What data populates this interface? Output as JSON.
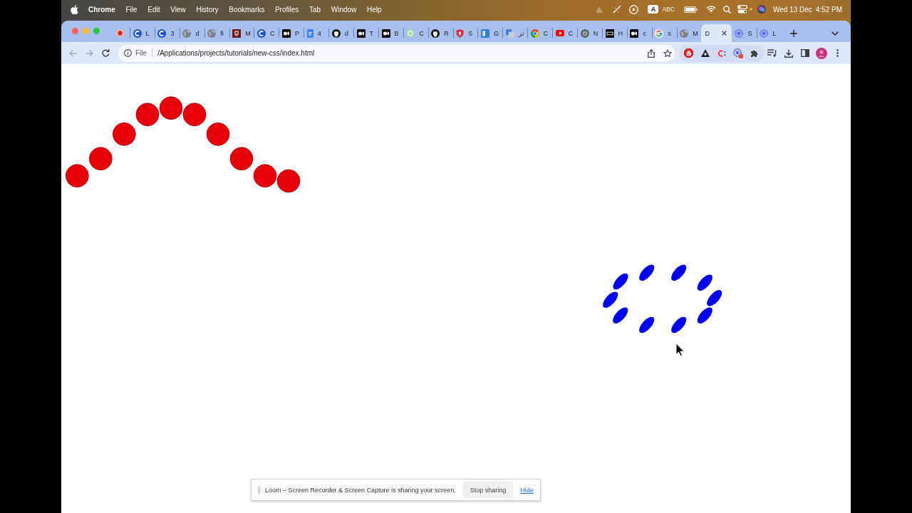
{
  "menu_bar": {
    "app": "Chrome",
    "menus": [
      "File",
      "Edit",
      "View",
      "History",
      "Bookmarks",
      "Profiles",
      "Tab",
      "Window",
      "Help"
    ],
    "input_badge": "A",
    "input_source": "ABC",
    "date": "Wed 13 Dec",
    "time": "4:52 PM"
  },
  "browser": {
    "tabs": [
      {
        "kind": "record",
        "pinned": true,
        "selected": false
      },
      {
        "kind": "c",
        "title": "L",
        "pinned": false,
        "selected": false
      },
      {
        "kind": "c",
        "title": "3",
        "pinned": false,
        "selected": false
      },
      {
        "kind": "globe",
        "title": "d",
        "pinned": false,
        "selected": false
      },
      {
        "kind": "globe",
        "title": "fi",
        "pinned": false,
        "selected": false
      },
      {
        "kind": "crest",
        "title": "M",
        "pinned": false,
        "selected": false
      },
      {
        "kind": "c",
        "title": "C",
        "pinned": false,
        "selected": false
      },
      {
        "kind": "dots",
        "title": "P",
        "pinned": false,
        "selected": false
      },
      {
        "kind": "doc",
        "title": "4",
        "pinned": false,
        "selected": false
      },
      {
        "kind": "cat",
        "title": "d",
        "pinned": false,
        "selected": false
      },
      {
        "kind": "dots",
        "title": "T",
        "pinned": false,
        "selected": false
      },
      {
        "kind": "dots",
        "title": "B",
        "pinned": false,
        "selected": false
      },
      {
        "kind": "flower",
        "title": "C",
        "pinned": false,
        "selected": false
      },
      {
        "kind": "cat",
        "title": "R",
        "pinned": false,
        "selected": false
      },
      {
        "kind": "shield",
        "title": "S",
        "pinned": false,
        "selected": false
      },
      {
        "kind": "panel",
        "title": "G",
        "pinned": false,
        "selected": false
      },
      {
        "kind": "translate",
        "title": "تر",
        "pinned": false,
        "selected": false
      },
      {
        "kind": "pinwheel",
        "title": "C",
        "pinned": false,
        "selected": false
      },
      {
        "kind": "video",
        "title": "C",
        "pinned": false,
        "selected": false
      },
      {
        "kind": "ring",
        "title": "N",
        "pinned": false,
        "selected": false
      },
      {
        "kind": "tile",
        "title": "H",
        "pinned": false,
        "selected": false
      },
      {
        "kind": "dots",
        "title": "c",
        "pinned": false,
        "selected": false
      },
      {
        "kind": "g",
        "title": "s",
        "pinned": false,
        "selected": false
      },
      {
        "kind": "globe",
        "title": "M",
        "pinned": false,
        "selected": false
      },
      {
        "title": "D",
        "pinned": false,
        "selected": true
      },
      {
        "kind": "sunburst",
        "title": "S",
        "pinned": false,
        "selected": false
      },
      {
        "kind": "sunburst",
        "title": "L",
        "pinned": false,
        "selected": false
      }
    ],
    "nav_buttons": [
      {
        "kind": "back",
        "disabled": true
      },
      {
        "kind": "forward",
        "disabled": true
      },
      {
        "kind": "reload",
        "disabled": false
      }
    ],
    "address_bar": {
      "scheme": "File",
      "url": "/Applications/projects/tutorials/new-css/index.html"
    }
  },
  "page": {
    "drawings": [
      {
        "kind": "dot-arc"
      },
      {
        "kind": "ellipse-ring"
      }
    ]
  },
  "sharing_bar": {
    "message": "Loom – Screen Recorder & Screen Capture is sharing your screen.",
    "button": "Stop sharing",
    "link": "Hide"
  }
}
